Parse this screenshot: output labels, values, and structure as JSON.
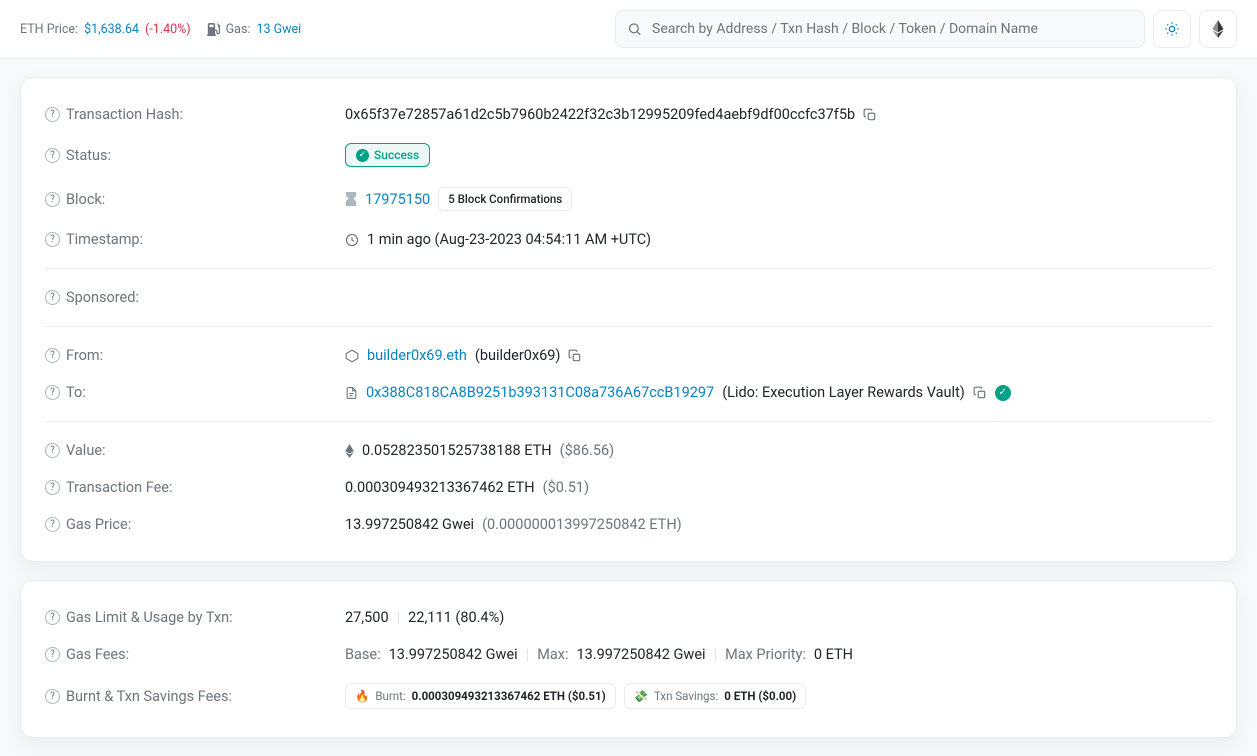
{
  "topbar": {
    "eth_label": "ETH Price:",
    "eth_price": "$1,638.64",
    "eth_change": "(-1.40%)",
    "gas_label": "Gas:",
    "gas_value": "13 Gwei",
    "search_placeholder": "Search by Address / Txn Hash / Block / Token / Domain Name"
  },
  "txn": {
    "hash_label": "Transaction Hash:",
    "hash": "0x65f37e72857a61d2c5b7960b2422f32c3b12995209fed4aebf9df00ccfc37f5b",
    "status_label": "Status:",
    "status": "Success",
    "block_label": "Block:",
    "block_number": "17975150",
    "confirmations": "5 Block Confirmations",
    "timestamp_label": "Timestamp:",
    "timestamp": "1 min ago (Aug-23-2023 04:54:11 AM +UTC)",
    "sponsored_label": "Sponsored:",
    "from_label": "From:",
    "from_addr": "builder0x69.eth",
    "from_name": "(builder0x69)",
    "to_label": "To:",
    "to_addr": "0x388C818CA8B9251b393131C08a736A67ccB19297",
    "to_name": "(Lido: Execution Layer Rewards Vault)",
    "value_label": "Value:",
    "value_eth": "0.052823501525738188 ETH",
    "value_usd": "($86.56)",
    "fee_label": "Transaction Fee:",
    "fee_eth": "0.000309493213367462 ETH",
    "fee_usd": "($0.51)",
    "gasprice_label": "Gas Price:",
    "gasprice_gwei": "13.997250842 Gwei",
    "gasprice_eth": "(0.000000013997250842 ETH)"
  },
  "gas": {
    "limit_label": "Gas Limit & Usage by Txn:",
    "limit": "27,500",
    "used": "22,111 (80.4%)",
    "fees_label": "Gas Fees:",
    "base_k": "Base:",
    "base_v": "13.997250842 Gwei",
    "max_k": "Max:",
    "max_v": "13.997250842 Gwei",
    "maxp_k": "Max Priority:",
    "maxp_v": "0 ETH",
    "burnt_label": "Burnt & Txn Savings Fees:",
    "burnt_k": "Burnt:",
    "burnt_v": "0.000309493213367462 ETH ($0.51)",
    "save_k": "Txn Savings:",
    "save_v": "0 ETH ($0.00)"
  }
}
